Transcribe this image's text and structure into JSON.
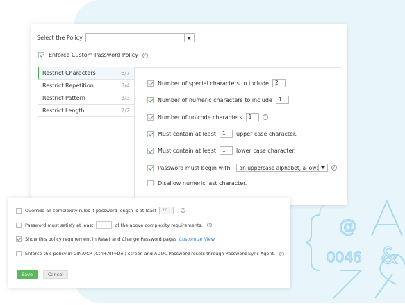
{
  "policy": {
    "label": "Select the Policy",
    "value": ""
  },
  "enforce": {
    "label": "Enforce Custom Password Policy",
    "checked": true
  },
  "tabs": [
    {
      "label": "Restrict Characters",
      "count": "6/7",
      "active": true
    },
    {
      "label": "Restrict Repetition",
      "count": "3/4",
      "active": false
    },
    {
      "label": "Restrict Pattern",
      "count": "3/3",
      "active": false
    },
    {
      "label": "Restrict Length",
      "count": "2/2",
      "active": false
    }
  ],
  "options": {
    "special": {
      "label": "Number of special characters to include",
      "value": "2",
      "checked": true
    },
    "numeric": {
      "label": "Number of numeric characters to include",
      "value": "1",
      "checked": true
    },
    "unicode": {
      "label": "Number of unicode characters",
      "value": "1",
      "checked": true
    },
    "upper": {
      "prefix": "Must contain at least",
      "value": "1",
      "suffix": "upper case character.",
      "checked": true
    },
    "lower": {
      "prefix": "Must contain at least",
      "value": "1",
      "suffix": "lower case character.",
      "checked": true
    },
    "begin": {
      "label": "Password must begin with",
      "value": "an uppercase alphabet, a lowe",
      "checked": true
    },
    "numeric_last": {
      "label": "Disallow numeric last character.",
      "checked": false
    }
  },
  "bottom": {
    "override": {
      "label": "Override all complexity rules if password length is at least",
      "value": "20",
      "checked": false
    },
    "satisfy": {
      "prefix": "Password must satisfy at least",
      "value": "",
      "suffix": "of the above complexity requirements.",
      "checked": false
    },
    "show": {
      "label": "Show this policy requirement in Reset and Change Password pages",
      "link": "Customize View",
      "checked": true
    },
    "gina": {
      "label": "Enforce this policy in GINA/CP (Ctrl+Alt+Del) screen and ADUC Password resets through Password Sync Agent.",
      "checked": false
    },
    "save_label": "Save",
    "cancel_label": "Cancel"
  },
  "decor": {
    "code": "0046",
    "symbols": "@&",
    "chars": "A 7%"
  },
  "colors": {
    "accent": "#4caf50",
    "link": "#2a7fd4",
    "background": "#e8f6fb"
  }
}
